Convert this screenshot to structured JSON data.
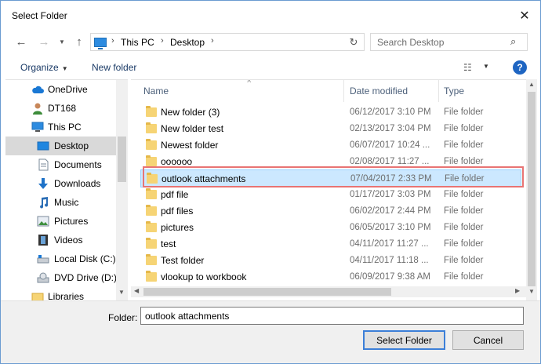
{
  "window": {
    "title": "Select Folder"
  },
  "address": {
    "crumbs": [
      "This PC",
      "Desktop"
    ]
  },
  "search": {
    "placeholder": "Search Desktop"
  },
  "toolbar": {
    "organize_label": "Organize",
    "new_folder_label": "New folder",
    "help_label": "?"
  },
  "nav": {
    "items": [
      {
        "label": "OneDrive",
        "icon": "cloud-icon"
      },
      {
        "label": "DT168",
        "icon": "user-icon"
      },
      {
        "label": "This PC",
        "icon": "computer-icon"
      },
      {
        "label": "Desktop",
        "icon": "desktop-icon",
        "selected": true
      },
      {
        "label": "Documents",
        "icon": "documents-icon"
      },
      {
        "label": "Downloads",
        "icon": "download-arrow-icon"
      },
      {
        "label": "Music",
        "icon": "music-icon"
      },
      {
        "label": "Pictures",
        "icon": "pictures-icon"
      },
      {
        "label": "Videos",
        "icon": "videos-icon"
      },
      {
        "label": "Local Disk (C:)",
        "icon": "disk-icon"
      },
      {
        "label": "DVD Drive (D:)",
        "icon": "dvd-icon"
      },
      {
        "label": "Libraries",
        "icon": "libraries-icon"
      }
    ]
  },
  "columns": {
    "name": "Name",
    "date": "Date modified",
    "type": "Type"
  },
  "files": [
    {
      "name": "New folder (3)",
      "date": "06/12/2017 3:10 PM",
      "type": "File folder"
    },
    {
      "name": "New folder test",
      "date": "02/13/2017 3:04 PM",
      "type": "File folder"
    },
    {
      "name": "Newest folder",
      "date": "06/07/2017 10:24 ...",
      "type": "File folder"
    },
    {
      "name": "oooooo",
      "date": "02/08/2017 11:27 ...",
      "type": "File folder"
    },
    {
      "name": "outlook attachments",
      "date": "07/04/2017 2:33 PM",
      "type": "File folder",
      "selected": true
    },
    {
      "name": "pdf file",
      "date": "01/17/2017 3:03 PM",
      "type": "File folder"
    },
    {
      "name": "pdf files",
      "date": "06/02/2017 2:44 PM",
      "type": "File folder"
    },
    {
      "name": "pictures",
      "date": "06/05/2017 3:10 PM",
      "type": "File folder"
    },
    {
      "name": "test",
      "date": "04/11/2017 11:27 ...",
      "type": "File folder"
    },
    {
      "name": "Test folder",
      "date": "04/11/2017 11:18 ...",
      "type": "File folder"
    },
    {
      "name": "vlookup to workbook",
      "date": "06/09/2017 9:38 AM",
      "type": "File folder"
    }
  ],
  "footer": {
    "folder_label": "Folder:",
    "folder_value": "outlook attachments",
    "select_label": "Select Folder",
    "cancel_label": "Cancel"
  },
  "colors": {
    "selection_bg": "#cce8ff",
    "highlight_border": "#e87474",
    "accent": "#1e65c2"
  }
}
